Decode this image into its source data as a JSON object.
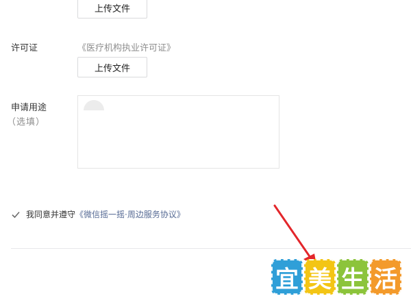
{
  "uploads": {
    "first_button": "上传文件",
    "second_button": "上传文件"
  },
  "license": {
    "label": "许可证",
    "hint": "《医疗机构执业许可证》"
  },
  "purpose": {
    "label": "申请用途",
    "optional": "（选填）",
    "value": ""
  },
  "agreement": {
    "checked": true,
    "prefix": "我同意并遵守",
    "link": "《微信摇一摇·周边服务协议》"
  },
  "watermark": {
    "chars": [
      "宜",
      "美",
      "生",
      "活"
    ],
    "colors": [
      "#2f9fd8",
      "#f3c515",
      "#8cc43b",
      "#f39a2b"
    ]
  },
  "colors": {
    "link": "#576b95",
    "arrow": "#e3262b",
    "check": "#6b6b6b"
  }
}
